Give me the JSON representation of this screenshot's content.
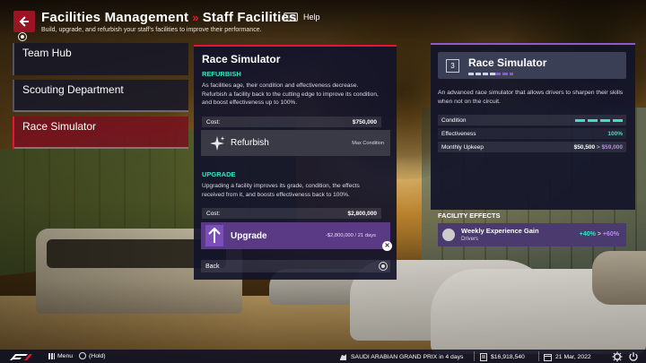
{
  "header": {
    "title": "Facilities Management",
    "crumb": "Staff Facilities",
    "help_label": "Help",
    "subtitle": "Build, upgrade, and refurbish your staff's facilities to improve their performance."
  },
  "sidebar": {
    "items": [
      {
        "label": "Team Hub"
      },
      {
        "label": "Scouting Department"
      },
      {
        "label": "Race Simulator"
      }
    ]
  },
  "center": {
    "title": "Race Simulator",
    "refurbish_heading": "REFURBISH",
    "refurbish_desc": "As facilities age, their condition and effectiveness decrease. Refurbish a facility back to the cutting edge to improve its condition, and boost effectiveness up to 100%.",
    "refurbish_cost_label": "Cost:",
    "refurbish_cost_value": "$750,000",
    "refurbish_button": "Refurbish",
    "refurbish_note": "Max Condition",
    "upgrade_heading": "UPGRADE",
    "upgrade_desc": "Upgrading a facility improves its grade, condition, the effects received from it, and boosts effectiveness back to 100%.",
    "upgrade_cost_label": "Cost:",
    "upgrade_cost_value": "$2,800,000",
    "upgrade_button": "Upgrade",
    "upgrade_note": "-$2,800,000 / 21 days",
    "back_label": "Back"
  },
  "right": {
    "grade": "3",
    "title": "Race Simulator",
    "description": "An advanced race simulator that allows drivers to sharpen their skills when not on the circuit.",
    "stats": {
      "condition_label": "Condition",
      "effectiveness_label": "Effectiveness",
      "effectiveness_value": "100%",
      "upkeep_label": "Monthly Upkeep",
      "upkeep_value": "$50,500",
      "upkeep_arrow": ">",
      "upkeep_new": "$59,000"
    },
    "effects_heading": "FACILITY EFFECTS",
    "effect": {
      "title": "Weekly Experience Gain",
      "subtitle": "Drivers",
      "current": "+40%",
      "arrow": ">",
      "new": "+60%"
    }
  },
  "footer": {
    "menu_label": "Menu",
    "hold_label": "(Hold)",
    "race_info": "SAUDI ARABIAN GRAND PRIX in 4 days",
    "money": "$16,918,540",
    "date": "21 Mar, 2022"
  },
  "colors": {
    "accent_red": "#e2182f",
    "accent_purple": "#8a5cd0",
    "accent_green": "#3be0c5",
    "panel_bg": "#12142a"
  },
  "icons": {
    "back": "arrow-left-icon",
    "help": "keyboard-key-icon",
    "refurbish": "sparkle-icon",
    "upgrade": "double-up-arrow-icon",
    "close": "close-icon",
    "effect": "helmet-icon",
    "settings": "gear-icon",
    "power": "power-icon"
  }
}
